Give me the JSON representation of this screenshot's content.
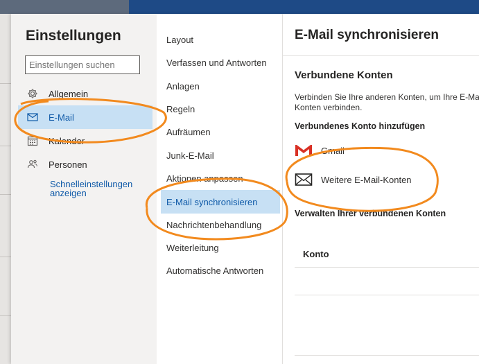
{
  "settings": {
    "title": "Einstellungen",
    "search_placeholder": "Einstellungen suchen"
  },
  "nav": {
    "items": [
      {
        "label": "Allgemein",
        "icon": "gear-icon"
      },
      {
        "label": "E-Mail",
        "icon": "mail-icon",
        "selected": true
      },
      {
        "label": "Kalender",
        "icon": "calendar-icon"
      },
      {
        "label": "Personen",
        "icon": "people-icon"
      }
    ],
    "quick_settings": "Schnelleinstellungen anzeigen"
  },
  "submenu": {
    "items": [
      "Layout",
      "Verfassen und Antworten",
      "Anlagen",
      "Regeln",
      "Aufräumen",
      "Junk-E-Mail",
      "Aktionen anpassen",
      "E-Mail synchronisieren",
      "Nachrichtenbehandlung",
      "Weiterleitung",
      "Automatische Antworten"
    ],
    "selected": "E-Mail synchronisieren"
  },
  "detail": {
    "title": "E-Mail synchronisieren",
    "connected_title": "Verbundene Konten",
    "description_line1": "Verbinden Sie Ihre anderen Konten, um Ihre E-Mail",
    "description_line2": "Konten verbinden.",
    "add_account_title": "Verbundenes Konto hinzufügen",
    "options": [
      {
        "label": "Gmail",
        "icon": "gmail-icon"
      },
      {
        "label": "Weitere E-Mail-Konten",
        "icon": "envelope-icon"
      }
    ],
    "manage_title": "Verwalten Ihrer verbundenen Konten",
    "table_header": "Konto"
  },
  "colors": {
    "accent": "#0f5aa8",
    "selected_bg": "#c7e0f4",
    "annotation": "#f28a1e"
  }
}
